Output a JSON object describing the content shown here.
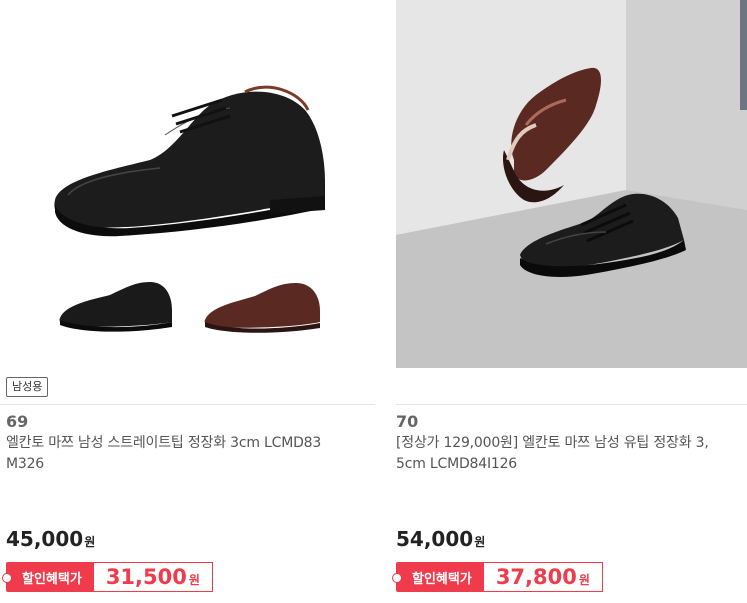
{
  "products": [
    {
      "tag": "남성용",
      "number": "69",
      "title_line1": "엘칸토 마쯔 남성 스트레이트팁 정장화 3cm LCMD83",
      "title_line2": "M326",
      "price": "45,000",
      "price_unit": "원",
      "benefit_label": "할인혜택가",
      "benefit_price": "31,500",
      "benefit_unit": "원"
    },
    {
      "number": "70",
      "title_line1": "[정상가 129,000원] 엘칸토 마쯔 남성 유팁 정장화 3,",
      "title_line2": "5cm LCMD84I126",
      "price": "54,000",
      "price_unit": "원",
      "benefit_label": "할인혜택가",
      "benefit_price": "37,800",
      "benefit_unit": "원"
    }
  ],
  "colors": {
    "accent": "#ef3b4c",
    "shoe_black": "#1c1c1c",
    "shoe_brown": "#5a2a22",
    "floor": "#c8c8c8",
    "wall": "#dedede"
  }
}
